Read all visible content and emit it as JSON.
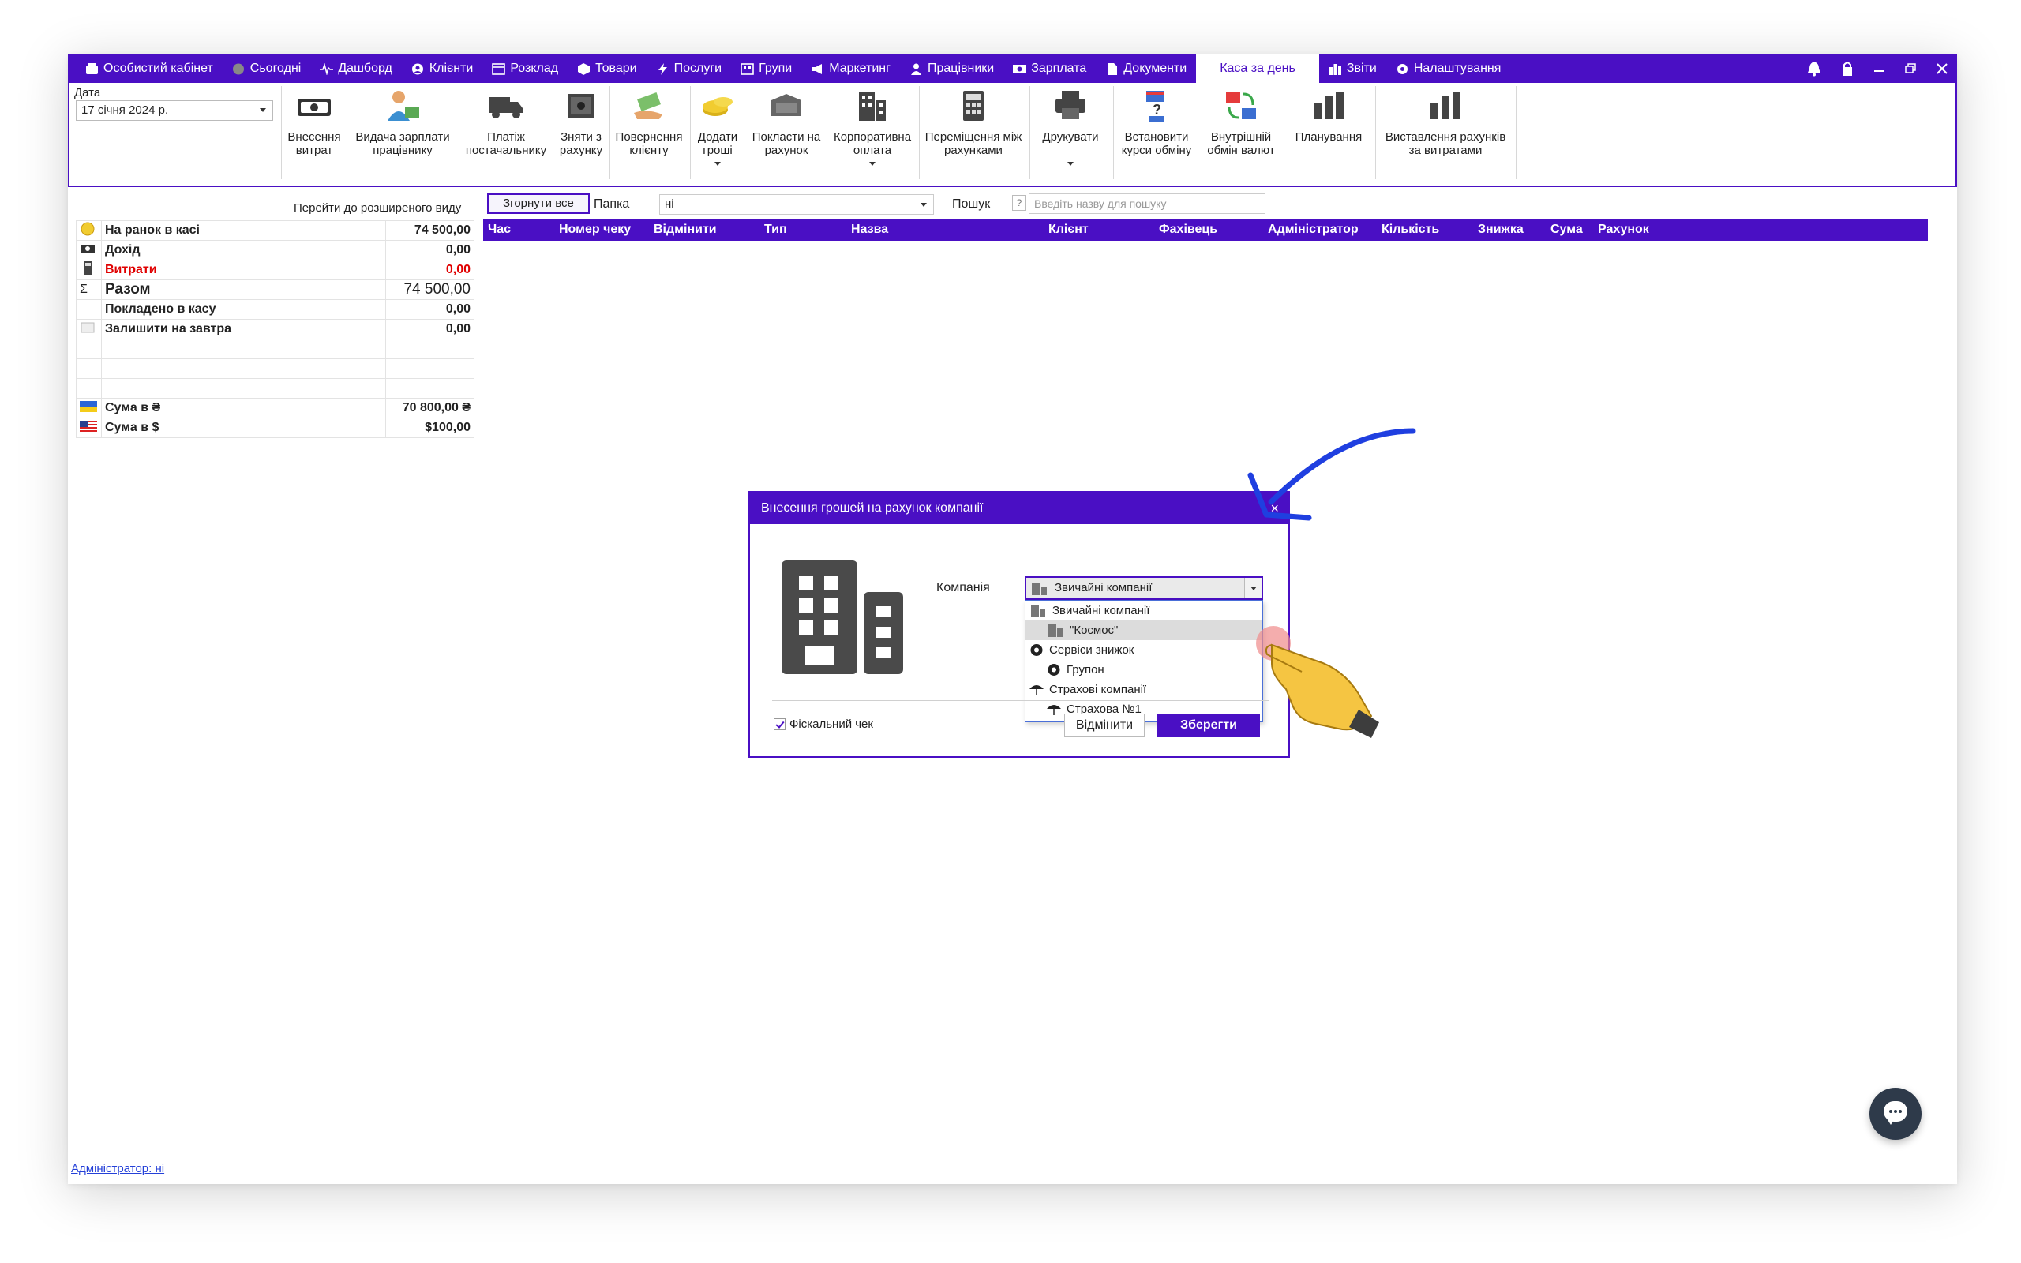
{
  "nav": {
    "items": [
      {
        "label": "Особистий кабінет",
        "icon": "wallet-icon"
      },
      {
        "label": "Сьогодні",
        "icon": "circle-icon"
      },
      {
        "label": "Дашборд",
        "icon": "pulse-icon"
      },
      {
        "label": "Клієнти",
        "icon": "user-circle-icon"
      },
      {
        "label": "Розклад",
        "icon": "calendar-icon"
      },
      {
        "label": "Товари",
        "icon": "box-icon"
      },
      {
        "label": "Послуги",
        "icon": "lightning-icon"
      },
      {
        "label": "Групи",
        "icon": "group-icon"
      },
      {
        "label": "Маркетинг",
        "icon": "megaphone-icon"
      },
      {
        "label": "Працівники",
        "icon": "person-icon"
      },
      {
        "label": "Зарплата",
        "icon": "money-icon"
      },
      {
        "label": "Документи",
        "icon": "document-icon"
      },
      {
        "label": "Каса за день",
        "icon": ""
      },
      {
        "label": "Звіти",
        "icon": "bar-chart-icon"
      },
      {
        "label": "Налаштування",
        "icon": "gear-icon"
      }
    ],
    "active": "Каса за день"
  },
  "ribbon": {
    "date_label": "Дата",
    "date_value": "17 січня 2024 р.",
    "buttons": [
      {
        "line1": "Внесення",
        "line2": "витрат"
      },
      {
        "line1": "Видача зарплати",
        "line2": "працівнику"
      },
      {
        "line1": "Платіж",
        "line2": "постачальнику"
      },
      {
        "line1": "Зняти з",
        "line2": "рахунку"
      },
      {
        "line1": "Повернення",
        "line2": "клієнту"
      },
      {
        "line1": "Додати",
        "line2": "гроші"
      },
      {
        "line1": "Покласти на",
        "line2": "рахунок"
      },
      {
        "line1": "Корпоративна",
        "line2": "оплата"
      },
      {
        "line1": "Переміщення між",
        "line2": "рахунками"
      },
      {
        "line1": "Друкувати",
        "line2": ""
      },
      {
        "line1": "Встановити",
        "line2": "курси обміну"
      },
      {
        "line1": "Внутрішній",
        "line2": "обмін валют"
      },
      {
        "line1": "Планування",
        "line2": ""
      },
      {
        "line1": "Виставлення рахунків",
        "line2": "за витратами"
      }
    ]
  },
  "left_panel": {
    "advanced_link": "Перейти до розширеного виду",
    "rows": [
      {
        "label": "На ранок в касі",
        "value": "74 500,00",
        "icon": "coin-icon"
      },
      {
        "label": "Дохід",
        "value": "0,00",
        "icon": "money-icon"
      },
      {
        "label": "Витрати",
        "value": "0,00",
        "icon": "calculator-icon"
      },
      {
        "label": "Разом",
        "value": "74 500,00",
        "icon": "sigma-icon"
      },
      {
        "label": "Покладено в касу",
        "value": "0,00",
        "icon": ""
      },
      {
        "label": "Залишити на завтра",
        "value": "0,00",
        "icon": "note-icon"
      },
      {
        "label": "",
        "value": "",
        "icon": ""
      },
      {
        "label": "",
        "value": "",
        "icon": ""
      },
      {
        "label": "",
        "value": "",
        "icon": ""
      },
      {
        "label": "Сума в ₴",
        "value": "70 800,00 ₴",
        "icon": "flag-ua-icon"
      },
      {
        "label": "Сума в $",
        "value": "$100,00",
        "icon": "flag-us-icon"
      }
    ],
    "expense_color": "#e00000"
  },
  "toolbar": {
    "collapse_label": "Згорнути все",
    "folder_label": "Папка",
    "folder_value": "ні",
    "search_label": "Пошук",
    "search_help": "?",
    "search_placeholder": "Введіть назву для пошуку"
  },
  "grid": {
    "columns": [
      "Час",
      "Номер чеку",
      "Відмінити",
      "Тип",
      "Назва",
      "Клієнт",
      "Фахівець",
      "Адміністратор",
      "Кількість",
      "Знижка",
      "Сума",
      "Рахунок"
    ]
  },
  "footer": {
    "admin_link": "Адміністратор: ні"
  },
  "dialog": {
    "title": "Внесення грошей на рахунок компанії",
    "close": "×",
    "company_label": "Компанія",
    "company_selected": "Звичайні компанії",
    "options": [
      {
        "label": "Звичайні компанії",
        "level": 0,
        "icon": "building-icon"
      },
      {
        "label": "\"Космос\"",
        "level": 1,
        "icon": "building-icon",
        "highlighted": true
      },
      {
        "label": "Сервіси знижок",
        "level": 0,
        "icon": "gear-icon"
      },
      {
        "label": "Групон",
        "level": 1,
        "icon": "gear-icon"
      },
      {
        "label": "Страхові компанії",
        "level": 0,
        "icon": "umbrella-icon"
      },
      {
        "label": "Страхова №1",
        "level": 1,
        "icon": "umbrella-icon"
      }
    ],
    "fiscal_label": "Фіскальний чек",
    "fiscal_checked": true,
    "cancel_label": "Відмінити",
    "save_label": "Зберегти"
  },
  "colors": {
    "brand": "#4a0fc4",
    "link": "#2440d8",
    "chat": "#2e3a4a"
  }
}
